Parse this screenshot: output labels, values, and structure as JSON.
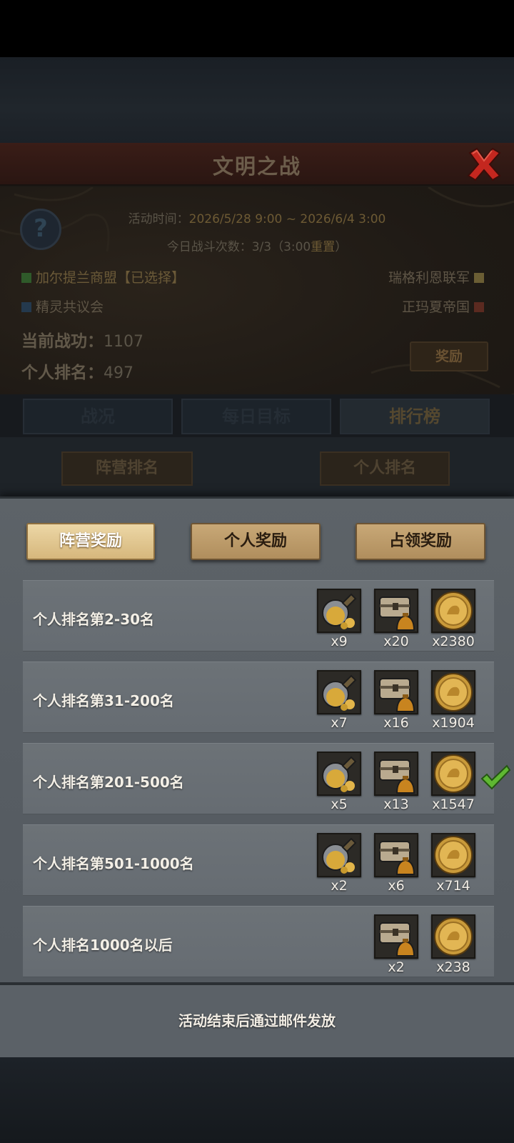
{
  "event": {
    "title": "文明之战",
    "time_label": "活动时间：",
    "time_value": "2026/5/28 9:00 ~ 2026/6/4 3:00",
    "battle_label": "今日战斗次数：",
    "battle_value": "3/3（3:00",
    "battle_reset": "重置",
    "battle_close": "）",
    "help_glyph": "?"
  },
  "factions": [
    {
      "name": "加尔提兰商盟【已选择】",
      "color": "#2f5a2a"
    },
    {
      "name": "瑞格利恩联军",
      "color": "#6b5e34"
    },
    {
      "name": "精灵共议会",
      "color": "#24394d"
    },
    {
      "name": "正玛夏帝国",
      "color": "#5b2a20"
    }
  ],
  "stats": {
    "merit_label": "当前战功：",
    "merit_value": "1107",
    "rank_label": "个人排名：",
    "rank_value": "497",
    "reward_button": "奖励"
  },
  "main_tabs": [
    "战况",
    "每日目标",
    "排行榜"
  ],
  "sub_tabs": [
    "阵营排名",
    "个人排名"
  ],
  "reward_tabs": [
    "阵营奖励",
    "个人奖励",
    "占领奖励"
  ],
  "rows": [
    {
      "label": "个人排名第2-30名",
      "items": [
        {
          "icon": "gold-flask-icon",
          "qty": "x9"
        },
        {
          "icon": "treasure-chest-icon",
          "qty": "x20"
        },
        {
          "icon": "gold-coin-icon",
          "qty": "x2380"
        }
      ],
      "current": false
    },
    {
      "label": "个人排名第31-200名",
      "items": [
        {
          "icon": "gold-flask-icon",
          "qty": "x7"
        },
        {
          "icon": "treasure-chest-icon",
          "qty": "x16"
        },
        {
          "icon": "gold-coin-icon",
          "qty": "x1904"
        }
      ],
      "current": false
    },
    {
      "label": "个人排名第201-500名",
      "items": [
        {
          "icon": "gold-flask-icon",
          "qty": "x5"
        },
        {
          "icon": "treasure-chest-icon",
          "qty": "x13"
        },
        {
          "icon": "gold-coin-icon",
          "qty": "x1547"
        }
      ],
      "current": true
    },
    {
      "label": "个人排名第501-1000名",
      "items": [
        {
          "icon": "gold-flask-icon",
          "qty": "x2"
        },
        {
          "icon": "treasure-chest-icon",
          "qty": "x6"
        },
        {
          "icon": "gold-coin-icon",
          "qty": "x714"
        }
      ],
      "current": false
    },
    {
      "label": "个人排名1000名以后",
      "items": [
        {
          "icon": "treasure-chest-icon",
          "qty": "x2"
        },
        {
          "icon": "gold-coin-icon",
          "qty": "x238"
        }
      ],
      "current": false
    }
  ],
  "notice": "活动结束后通过邮件发放",
  "colors": {
    "accent_gold": "#d6b77c",
    "check_green": "#5fb832",
    "close_red": "#c4271f"
  }
}
